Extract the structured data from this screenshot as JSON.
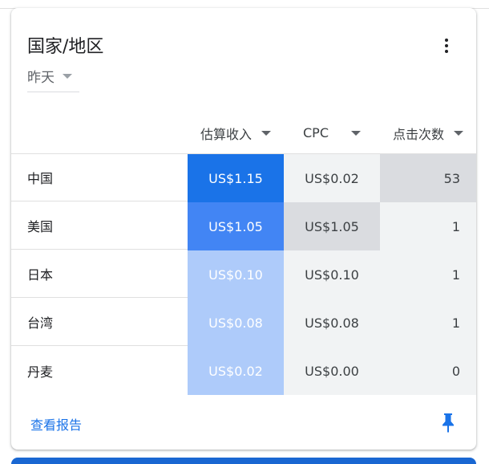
{
  "card": {
    "title": "国家/地区",
    "date_filter": "昨天",
    "columns": [
      {
        "label": "估算收入"
      },
      {
        "label": "CPC"
      },
      {
        "label": "点击次数"
      }
    ],
    "rows": [
      {
        "country": "中国",
        "revenue": "US$1.15",
        "cpc": "US$0.02",
        "clicks": "53",
        "revenue_bg": "#1a73e8",
        "revenue_color": "#ffffff",
        "cpc_bg": "#f1f3f4",
        "clicks_bg": "#dadce0"
      },
      {
        "country": "美国",
        "revenue": "US$1.05",
        "cpc": "US$1.05",
        "clicks": "1",
        "revenue_bg": "#4285f4",
        "revenue_color": "#ffffff",
        "cpc_bg": "#dadce0",
        "clicks_bg": "#f1f3f4"
      },
      {
        "country": "日本",
        "revenue": "US$0.10",
        "cpc": "US$0.10",
        "clicks": "1",
        "revenue_bg": "#aecbfa",
        "revenue_color": "#ffffff",
        "cpc_bg": "#f1f3f4",
        "clicks_bg": "#f1f3f4"
      },
      {
        "country": "台湾",
        "revenue": "US$0.08",
        "cpc": "US$0.08",
        "clicks": "1",
        "revenue_bg": "#aecbfa",
        "revenue_color": "#ffffff",
        "cpc_bg": "#f1f3f4",
        "clicks_bg": "#f1f3f4"
      },
      {
        "country": "丹麦",
        "revenue": "US$0.02",
        "cpc": "US$0.00",
        "clicks": "0",
        "revenue_bg": "#aecbfa",
        "revenue_color": "#ffffff",
        "cpc_bg": "#f1f3f4",
        "clicks_bg": "#f1f3f4"
      }
    ],
    "footer_link": "查看报告",
    "icons": {
      "menu": "more-vert-icon",
      "pin": "pin-icon",
      "dropdown": "caret-down-icon"
    },
    "accent_color": "#1a73e8"
  }
}
